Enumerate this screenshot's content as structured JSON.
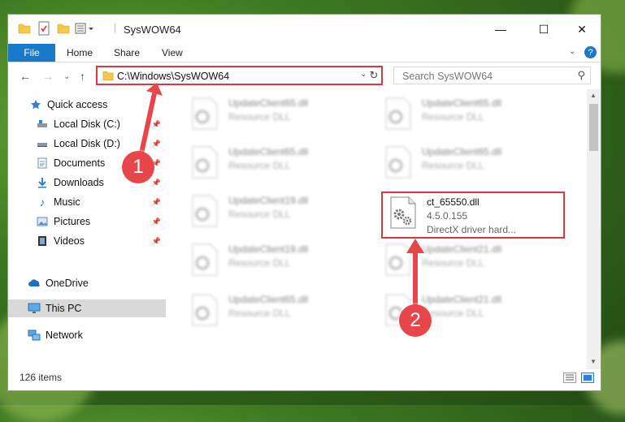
{
  "window": {
    "title": "SysWOW64",
    "minimize": "—",
    "maximize": "☐",
    "close": "✕",
    "help": "?"
  },
  "ribbon": {
    "file": "File",
    "home": "Home",
    "share": "Share",
    "view": "View"
  },
  "address": {
    "path": "C:\\Windows\\SysWOW64",
    "search_placeholder": "Search SysWOW64"
  },
  "sidebar": {
    "items": [
      {
        "label": "Quick access",
        "icon": "star-icon"
      },
      {
        "label": "Local Disk (C:)",
        "icon": "drive-icon"
      },
      {
        "label": "Local Disk (D:)",
        "icon": "drive-icon"
      },
      {
        "label": "Documents",
        "icon": "documents-icon"
      },
      {
        "label": "Downloads",
        "icon": "download-icon"
      },
      {
        "label": "Music",
        "icon": "music-icon"
      },
      {
        "label": "Pictures",
        "icon": "pictures-icon"
      },
      {
        "label": "Videos",
        "icon": "videos-icon"
      },
      {
        "label": "OneDrive",
        "icon": "cloud-icon"
      },
      {
        "label": "This PC",
        "icon": "computer-icon"
      },
      {
        "label": "Network",
        "icon": "network-icon"
      }
    ]
  },
  "files": [
    {
      "name": "UpdateClient65.dll",
      "type": "Resource DLL"
    },
    {
      "name": "UpdateClient65.dll",
      "type": "Resource DLL"
    },
    {
      "name": "UpdateClient65.dll",
      "type": "Resource DLL"
    },
    {
      "name": "UpdateClient65.dll",
      "type": "Resource DLL"
    },
    {
      "name": "UpdateClient19.dll",
      "type": "Resource DLL"
    },
    {
      "name": "ct_65550.dll",
      "version": "4.5.0.155",
      "description": "DirectX driver hard..."
    },
    {
      "name": "UpdateClient19.dll",
      "type": "Resource DLL"
    },
    {
      "name": "UpdateClient21.dll",
      "type": "Resource DLL"
    },
    {
      "name": "UpdateClient65.dll",
      "type": "Resource DLL"
    },
    {
      "name": "UpdateClient21.dll",
      "type": "Resource DLL"
    }
  ],
  "status": {
    "item_count": "126 items"
  },
  "callouts": {
    "one": "1",
    "two": "2"
  },
  "colors": {
    "accent": "#1979ca",
    "highlight": "#d9383f",
    "callout": "#e7464b"
  }
}
